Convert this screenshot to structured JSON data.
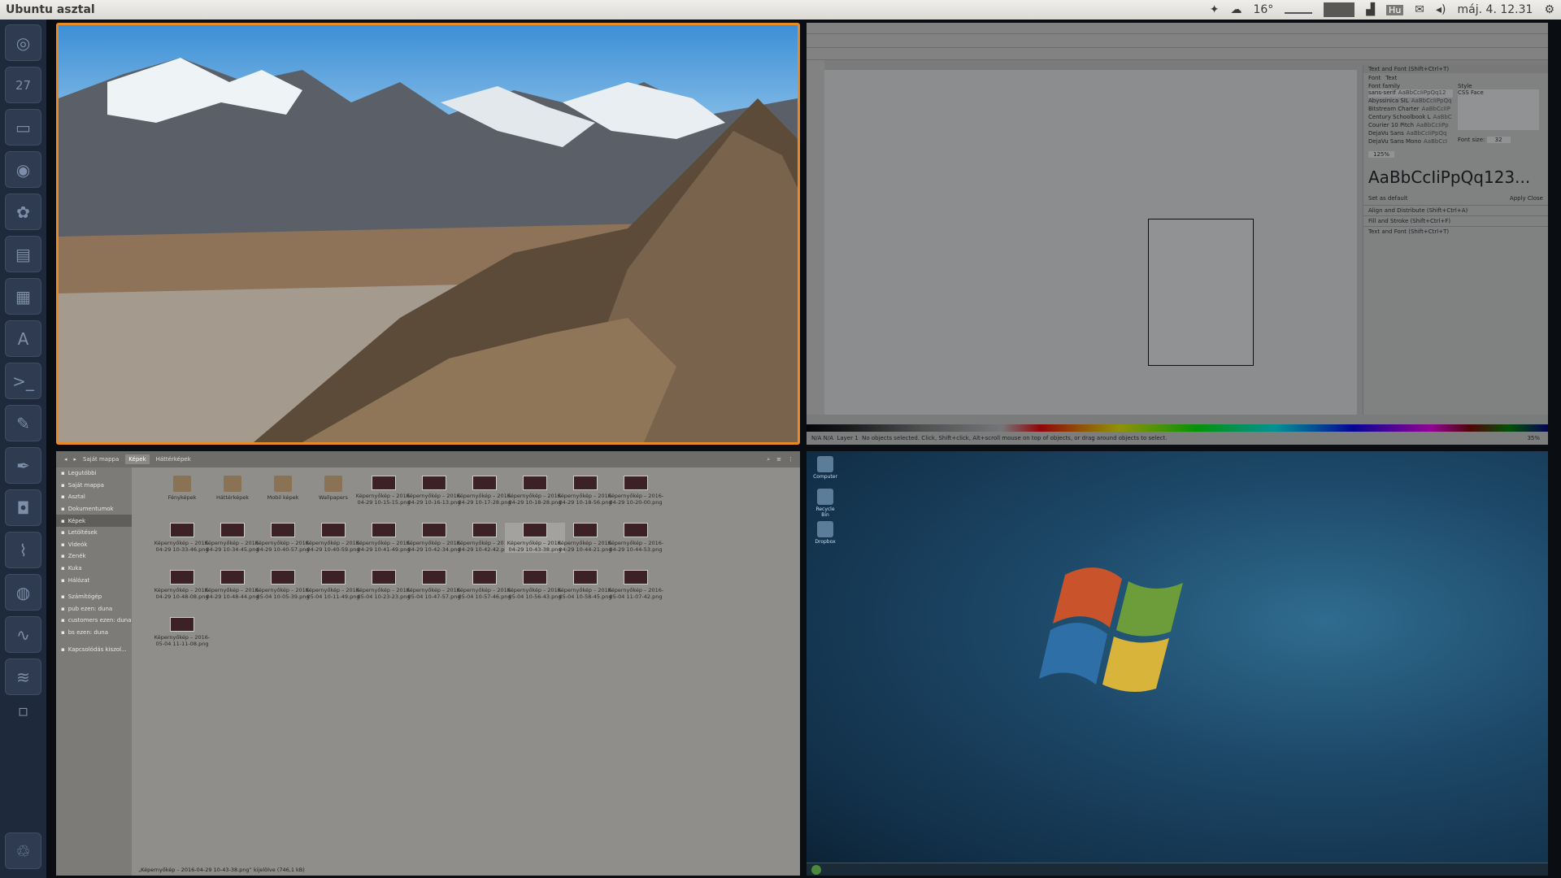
{
  "topbar": {
    "title": "Ubuntu asztal",
    "weather_temp": "16°",
    "keyboard_layout": "Hu",
    "datetime": "máj. 4. 12.31",
    "icons": [
      "dropbox-icon",
      "weather-icon",
      "network-graph-icon",
      "cpu-icon",
      "signal-icon",
      "keyboard-icon",
      "mail-icon",
      "volume-icon",
      "gear-icon"
    ]
  },
  "launcher": {
    "items": [
      "ubuntu-logo-icon",
      "calendar-icon",
      "files-icon",
      "browser-icon",
      "settings-icon",
      "document-icon",
      "spreadsheet-icon",
      "software-center-icon",
      "terminal-icon",
      "tools-icon",
      "inkscape-icon",
      "camera-icon",
      "system-monitor-icon",
      "disk-icon",
      "waveform-icon",
      "spotify-icon",
      "workspace-icon",
      "trash-icon"
    ],
    "calendar_day": "27"
  },
  "inkscape": {
    "dock_title": "Text and Font (Shift+Ctrl+T)",
    "dock_tabs": [
      "Font",
      "Text"
    ],
    "font_family_label": "Font family",
    "style_label": "Style",
    "style_value": "CSS   Face",
    "fonts": [
      {
        "name": "sans-serif",
        "sample": "AaBbCcIiPpQq12"
      },
      {
        "name": "Abyssinica SIL",
        "sample": "AaBbCcIiPpQq"
      },
      {
        "name": "Bitstream Charter",
        "sample": "AaBbCcIiP"
      },
      {
        "name": "Century Schoolbook L",
        "sample": "AaBbC"
      },
      {
        "name": "Courier 10 Pitch",
        "sample": "AaBbCcIiPp"
      },
      {
        "name": "DejaVu Sans",
        "sample": "AaBbCcIiPpQq"
      },
      {
        "name": "DejaVu Sans Mono",
        "sample": "AaBbCcI"
      }
    ],
    "font_size_label": "Font size:",
    "font_size_value": "32",
    "line_spacing_value": "125%",
    "preview_text": "AaBbCcIiPpQq123...",
    "set_default": "Set as default",
    "apply_label": "Apply",
    "close_label": "Close",
    "collapsed_docks": [
      "Align and Distribute (Shift+Ctrl+A)",
      "Fill and Stroke (Shift+Ctrl+F)",
      "Text and Font (Shift+Ctrl+T)"
    ],
    "status_layer": "Layer 1",
    "status_text": "No objects selected. Click, Shift+click, Alt+scroll mouse on top of objects, or drag around objects to select.",
    "status_fill": "N/A",
    "status_stroke": "N/A",
    "zoom": "35%"
  },
  "nautilus": {
    "breadcrumbs": [
      "Saját mappa",
      "Képek",
      "Háttérképek"
    ],
    "sidebar": [
      {
        "icon": "recent-icon",
        "label": "Legutóbbi"
      },
      {
        "icon": "home-icon",
        "label": "Saját mappa"
      },
      {
        "icon": "desktop-icon",
        "label": "Asztal"
      },
      {
        "icon": "folder-icon",
        "label": "Dokumentumok"
      },
      {
        "icon": "folder-icon",
        "label": "Képek"
      },
      {
        "icon": "folder-icon",
        "label": "Letöltések"
      },
      {
        "icon": "folder-icon",
        "label": "Videók"
      },
      {
        "icon": "folder-icon",
        "label": "Zenék"
      },
      {
        "icon": "trash-icon",
        "label": "Kuka"
      },
      {
        "icon": "network-icon",
        "label": "Hálózat"
      },
      {
        "icon": "computer-icon",
        "label": "Számítógép"
      },
      {
        "icon": "network-icon",
        "label": "pub ezen: duna"
      },
      {
        "icon": "network-icon",
        "label": "customers ezen: duna"
      },
      {
        "icon": "network-icon",
        "label": "bs ezen: duna"
      },
      {
        "icon": "network-icon",
        "label": "Kapcsolódás kiszol..."
      }
    ],
    "folders": [
      "Fényképek",
      "Háttérképek",
      "Mobil képek",
      "Wallpapers"
    ],
    "files": [
      "Képernyőkép – 2016-04-29 10-15-15.png",
      "Képernyőkép – 2016-04-29 10-16-13.png",
      "Képernyőkép – 2016-04-29 10-17-28.png",
      "Képernyőkép – 2016-04-29 10-18-28.png",
      "Képernyőkép – 2016-04-29 10-18-56.png",
      "Képernyőkép – 2016-04-29 10-20-00.png",
      "Képernyőkép – 2016-04-29 10-33-46.png",
      "Képernyőkép – 2016-04-29 10-34-45.png",
      "Képernyőkép – 2016-04-29 10-40-57.png",
      "Képernyőkép – 2016-04-29 10-40-59.png",
      "Képernyőkép – 2016-04-29 10-41-49.png",
      "Képernyőkép – 2016-04-29 10-42-34.png",
      "Képernyőkép – 2016-04-29 10-42-42.png",
      "Képernyőkép – 2016-04-29 10-43-38.png",
      "Képernyőkép – 2016-04-29 10-44-21.png",
      "Képernyőkép – 2016-04-29 10-44-53.png",
      "Képernyőkép – 2016-04-29 10-48-08.png",
      "Képernyőkép – 2016-04-29 10-48-44.png",
      "Képernyőkép – 2016-05-04 10-05-39.png",
      "Képernyőkép – 2016-05-04 10-11-49.png",
      "Képernyőkép – 2016-05-04 10-23-23.png",
      "Képernyőkép – 2016-05-04 10-47-57.png",
      "Képernyőkép – 2016-05-04 10-57-46.png",
      "Képernyőkép – 2016-05-04 10-56-43.png",
      "Képernyőkép – 2016-05-04 10-58-45.png",
      "Képernyőkép – 2016-05-04 11-07-42.png",
      "Képernyőkép – 2016-05-04 11-11-08.png"
    ],
    "selected_index": 13,
    "status": "„Képernyőkép – 2016-04-29 10-43-38.png” kijelölve (746,1 kB)"
  },
  "windows": {
    "desktop_icons": [
      "Computer",
      "Recycle Bin",
      "Dropbox"
    ]
  }
}
